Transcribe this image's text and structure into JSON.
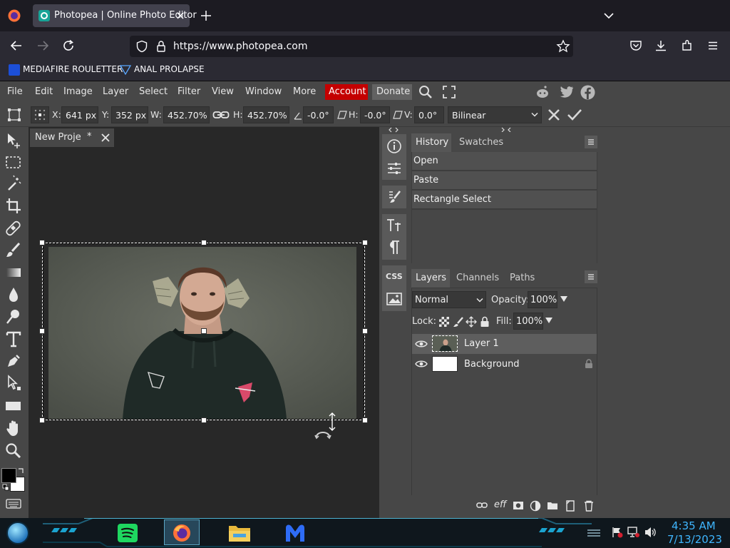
{
  "browser": {
    "tab_title": "Photopea | Online Photo Editor",
    "url": "https://www.photopea.com",
    "bookmarks": [
      "MEDIAFIRE ROULETTER",
      "ANAL PROLAPSE"
    ]
  },
  "menu": {
    "items": [
      "File",
      "Edit",
      "Image",
      "Layer",
      "Select",
      "Filter",
      "View",
      "Window",
      "More"
    ],
    "account": "Account",
    "donate": "Donate"
  },
  "options": {
    "x_label": "X:",
    "x_value": "641 px",
    "y_label": "Y:",
    "y_value": "352 px",
    "w_label": "W:",
    "w_value": "452.70%",
    "h_label": "H:",
    "h_value": "452.70%",
    "angle_value": "-0.0°",
    "skew_h_label": "H:",
    "skew_h_value": "-0.0°",
    "skew_v_label": "V:",
    "skew_v_value": "0.0°",
    "interpolation": "Bilinear"
  },
  "document": {
    "tab_name": "New Proje",
    "modified_mark": "*"
  },
  "history": {
    "tabs": [
      "History",
      "Swatches"
    ],
    "items": [
      "Open",
      "Paste",
      "Rectangle Select"
    ]
  },
  "sidestrip": {
    "css_label": "CSS"
  },
  "layers": {
    "tabs": [
      "Layers",
      "Channels",
      "Paths"
    ],
    "blend_mode": "Normal",
    "opacity_label": "Opacity:",
    "opacity_value": "100%",
    "lock_label": "Lock:",
    "fill_label": "Fill:",
    "fill_value": "100%",
    "items": [
      {
        "name": "Layer 1",
        "selected": true
      },
      {
        "name": "Background",
        "locked": true
      }
    ],
    "footer_effects_label": "eff"
  },
  "taskbar": {
    "time": "4:35 AM",
    "date": "7/13/2023"
  },
  "colors": {
    "accent_red": "#c40000",
    "panel_bg": "#474747",
    "workspace_bg": "#282828",
    "clock_color": "#3fb6ff"
  }
}
